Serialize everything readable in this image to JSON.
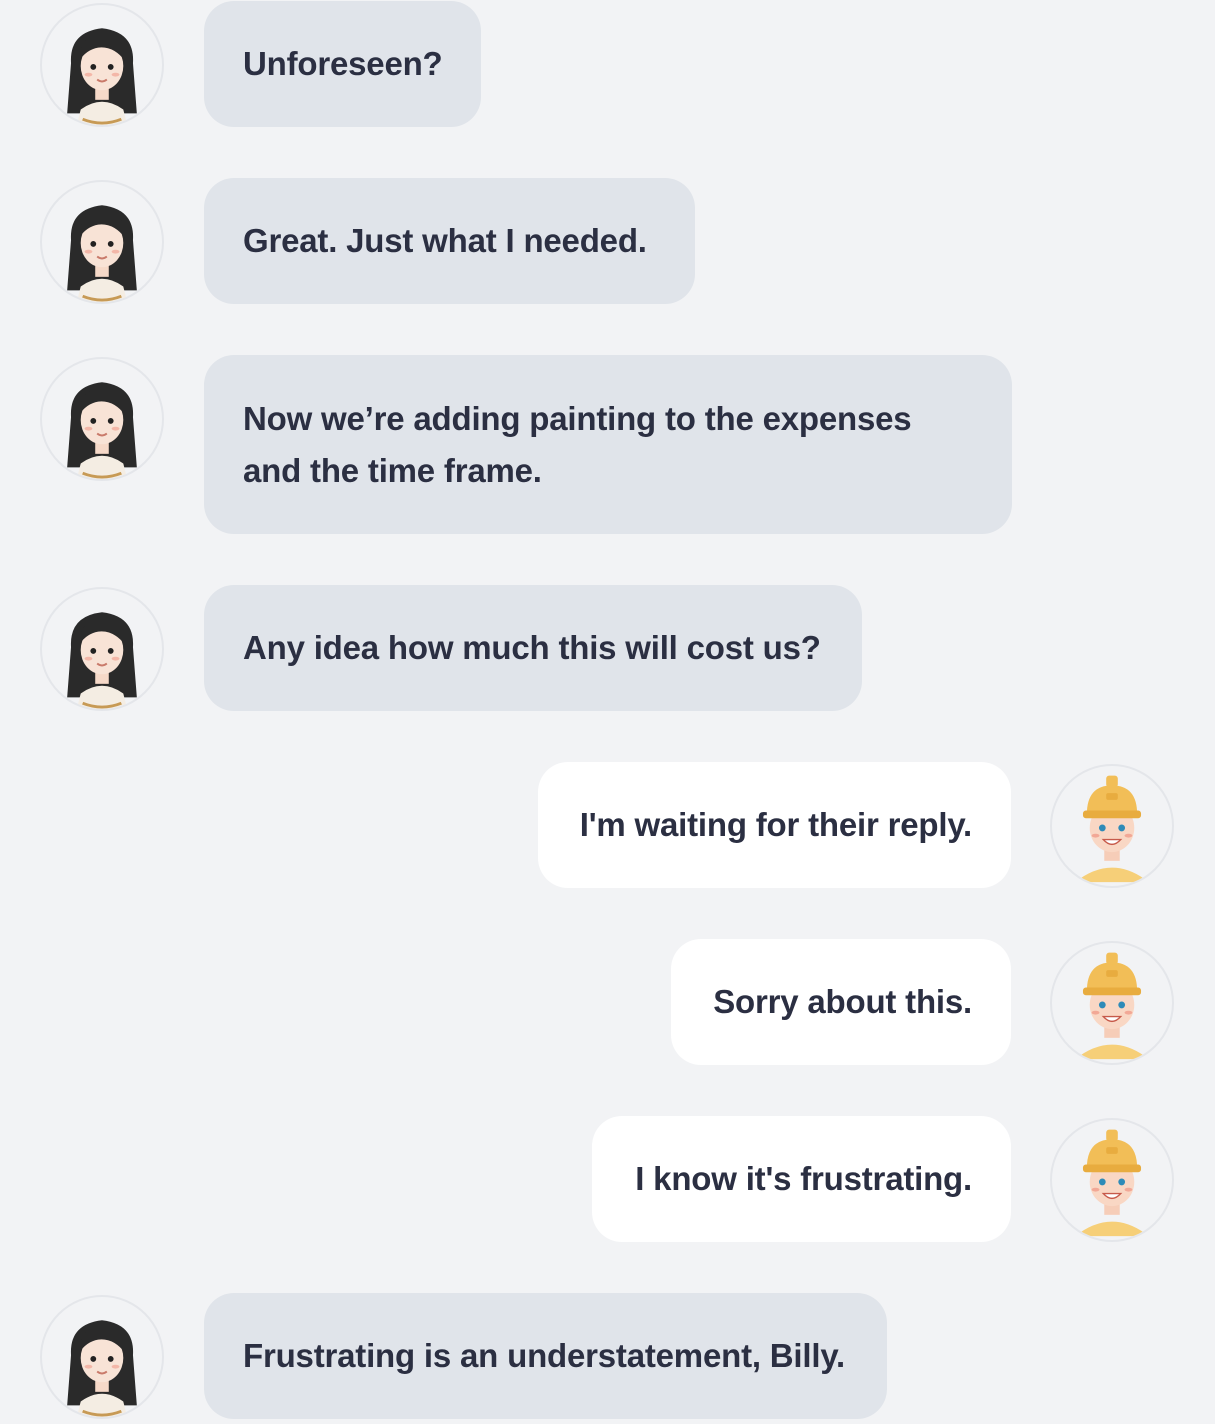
{
  "contacts": {
    "other": {
      "avatar_icon": "woman-avatar-icon"
    },
    "self": {
      "name": "Billy",
      "avatar_icon": "construction-worker-avatar-icon"
    }
  },
  "colors": {
    "background": "#f2f3f5",
    "incoming_bubble": "#e0e4ea",
    "outgoing_bubble": "#ffffff",
    "text": "#2b2f42",
    "worker_helmet": "#f2be57"
  },
  "messages": [
    {
      "sender": "other",
      "text": "Unforeseen?"
    },
    {
      "sender": "other",
      "text": "Great. Just what I needed."
    },
    {
      "sender": "other",
      "text": "Now we’re adding painting to the expenses and the time frame."
    },
    {
      "sender": "other",
      "text": "Any idea how much this will cost us?"
    },
    {
      "sender": "self",
      "text": "I'm waiting for their reply."
    },
    {
      "sender": "self",
      "text": "Sorry about this."
    },
    {
      "sender": "self",
      "text": "I know it's frustrating."
    },
    {
      "sender": "other",
      "text": "Frustrating is an understatement, Billy."
    }
  ]
}
